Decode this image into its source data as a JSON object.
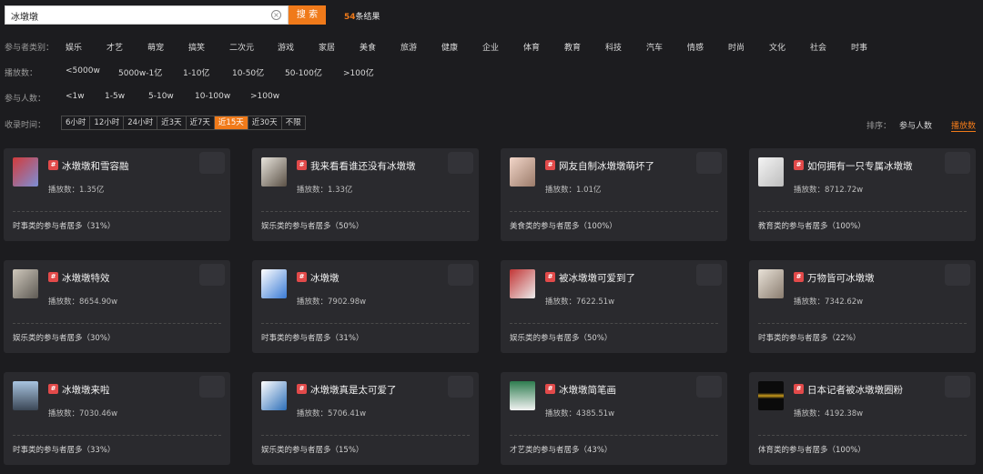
{
  "search": {
    "value": "冰墩墩",
    "button_label": "搜 索",
    "result_num": "54",
    "result_suffix": "条结果"
  },
  "filters": {
    "category": {
      "label": "参与者类别：",
      "options": [
        "娱乐",
        "才艺",
        "萌宠",
        "搞笑",
        "二次元",
        "游戏",
        "家居",
        "美食",
        "旅游",
        "健康",
        "企业",
        "体育",
        "教育",
        "科技",
        "汽车",
        "情感",
        "时尚",
        "文化",
        "社会",
        "时事"
      ]
    },
    "plays": {
      "label": "播放数：",
      "options": [
        "<5000w",
        "5000w-1亿",
        "1-10亿",
        "10-50亿",
        "50-100亿",
        ">100亿"
      ]
    },
    "participants": {
      "label": "参与人数：",
      "options": [
        "<1w",
        "1-5w",
        "5-10w",
        "10-100w",
        ">100w"
      ]
    },
    "time": {
      "label": "收录时间：",
      "options": [
        "6小时",
        "12小时",
        "24小时",
        "近3天",
        "近7天",
        "近15天",
        "近30天",
        "不限"
      ],
      "active": "近15天"
    }
  },
  "sort": {
    "label": "排序：",
    "options": [
      "参与人数",
      "播放数"
    ],
    "active": "播放数"
  },
  "colors": {
    "accent": "#f07a1a",
    "tag": "#e24a4a",
    "card_bg": "#2a2a2e",
    "page_bg": "#1c1c1f"
  },
  "cards": [
    {
      "title": "冰墩墩和雪容融",
      "plays": "播放数：1.35亿",
      "footer": "时事类的参与者居多（31%）",
      "tag": "#"
    },
    {
      "title": "我来看看谁还没有冰墩墩",
      "plays": "播放数：1.33亿",
      "footer": "娱乐类的参与者居多（50%）",
      "tag": "#"
    },
    {
      "title": "网友自制冰墩墩萌坏了",
      "plays": "播放数：1.01亿",
      "footer": "美食类的参与者居多（100%）",
      "tag": "#"
    },
    {
      "title": "如何拥有一只专属冰墩墩",
      "plays": "播放数：8712.72w",
      "footer": "教育类的参与者居多（100%）",
      "tag": "#"
    },
    {
      "title": "冰墩墩特效",
      "plays": "播放数：8654.90w",
      "footer": "娱乐类的参与者居多（30%）",
      "tag": "#"
    },
    {
      "title": "冰墩墩",
      "plays": "播放数：7902.98w",
      "footer": "时事类的参与者居多（31%）",
      "tag": "#"
    },
    {
      "title": "被冰墩墩可爱到了",
      "plays": "播放数：7622.51w",
      "footer": "娱乐类的参与者居多（50%）",
      "tag": "#"
    },
    {
      "title": "万物皆可冰墩墩",
      "plays": "播放数：7342.62w",
      "footer": "时事类的参与者居多（22%）",
      "tag": "#"
    },
    {
      "title": "冰墩墩来啦",
      "plays": "播放数：7030.46w",
      "footer": "时事类的参与者居多（33%）",
      "tag": "#"
    },
    {
      "title": "冰墩墩真是太可爱了",
      "plays": "播放数：5706.41w",
      "footer": "娱乐类的参与者居多（15%）",
      "tag": "#"
    },
    {
      "title": "冰墩墩简笔画",
      "plays": "播放数：4385.51w",
      "footer": "才艺类的参与者居多（43%）",
      "tag": "#"
    },
    {
      "title": "日本记者被冰墩墩圈粉",
      "plays": "播放数：4192.38w",
      "footer": "体育类的参与者居多（100%）",
      "tag": "#"
    }
  ]
}
